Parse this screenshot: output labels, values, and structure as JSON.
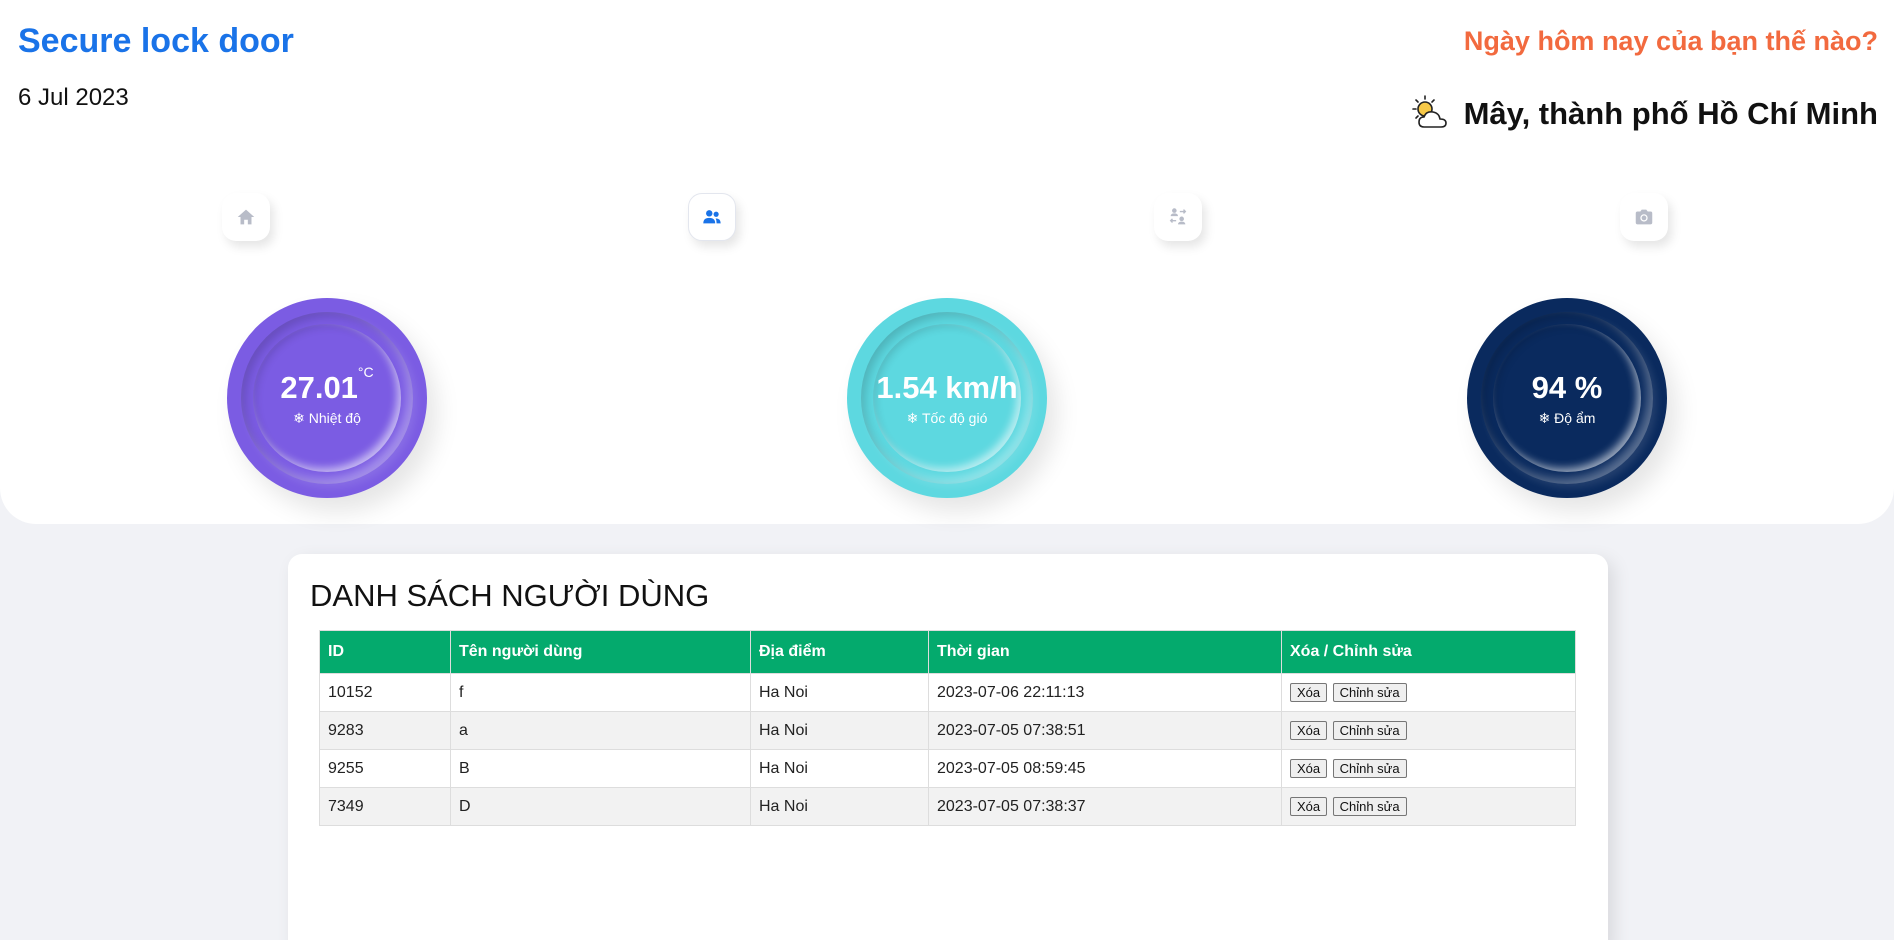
{
  "header": {
    "app_title": "Secure lock door",
    "date": "6 Jul 2023",
    "greeting": "Ngày hôm nay của bạn thế nào?",
    "weather_text": "Mây, thành phố Hồ Chí Minh",
    "weather_icon": "partly-cloudy-icon"
  },
  "nav": [
    {
      "icon": "home-icon",
      "active": false
    },
    {
      "icon": "users-icon",
      "active": true
    },
    {
      "icon": "user-transfer-icon",
      "active": false
    },
    {
      "icon": "camera-icon",
      "active": false
    }
  ],
  "gauges": {
    "temperature": {
      "value": "27.01",
      "unit": "°C",
      "label": "❄ Nhiệt độ",
      "color": "#7b5ce3"
    },
    "wind": {
      "value": "1.54 km/h",
      "label": "❄ Tốc độ gió",
      "color": "#5dd8e0"
    },
    "humidity": {
      "value": "94 %",
      "label": "❄ Độ ẩm",
      "color": "#0a2a5e"
    }
  },
  "user_table": {
    "title": "DANH SÁCH NGƯỜI DÙNG",
    "columns": [
      "ID",
      "Tên người dùng",
      "Địa điểm",
      "Thời gian",
      "Xóa / Chỉnh sửa"
    ],
    "delete_label": "Xóa",
    "edit_label": "Chỉnh sửa",
    "rows": [
      {
        "id": "10152",
        "name": "f",
        "location": "Ha Noi",
        "time": "2023-07-06 22:11:13"
      },
      {
        "id": "9283",
        "name": "a",
        "location": "Ha Noi",
        "time": "2023-07-05 07:38:51"
      },
      {
        "id": "9255",
        "name": "B",
        "location": "Ha Noi",
        "time": "2023-07-05 08:59:45"
      },
      {
        "id": "7349",
        "name": "D",
        "location": "Ha Noi",
        "time": "2023-07-05 07:38:37"
      }
    ],
    "header_color": "#04aa6d"
  },
  "colors": {
    "title": "#1a73e8",
    "greeting": "#f26a3f",
    "nav_active": "#1a73e8",
    "nav_inactive": "#b8bcc8"
  }
}
